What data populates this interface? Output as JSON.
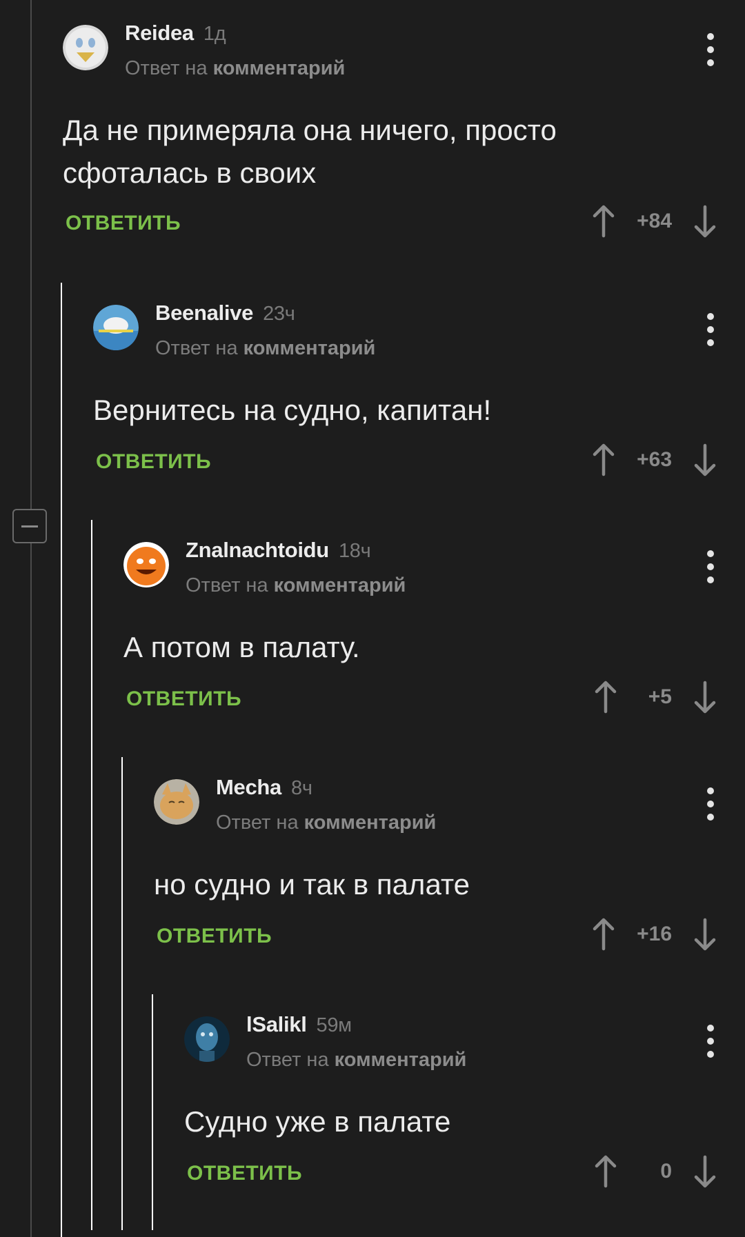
{
  "comments": [
    {
      "author": "Reidea",
      "time": "1д",
      "reply_prefix": "Ответ на",
      "reply_target": "комментарий",
      "text": "Да не примеряла она ничего, просто\nсфоталась в своих",
      "reply_label": "ОТВЕТИТЬ",
      "score": "+84"
    },
    {
      "author": "Beenalive",
      "time": "23ч",
      "reply_prefix": "Ответ на",
      "reply_target": "комментарий",
      "text": "Вернитесь на судно, капитан!",
      "reply_label": "ОТВЕТИТЬ",
      "score": "+63"
    },
    {
      "author": "Znalnachtoidu",
      "time": "18ч",
      "reply_prefix": "Ответ на",
      "reply_target": "комментарий",
      "text": "А потом в палату.",
      "reply_label": "ОТВЕТИТЬ",
      "score": "+5"
    },
    {
      "author": "Mecha",
      "time": "8ч",
      "reply_prefix": "Ответ на",
      "reply_target": "комментарий",
      "text": "но судно и так в палате",
      "reply_label": "ОТВЕТИТЬ",
      "score": "+16"
    },
    {
      "author": "lSalikl",
      "time": "59м",
      "reply_prefix": "Ответ на",
      "reply_target": "комментарий",
      "text": "Судно уже в палате",
      "reply_label": "ОТВЕТИТЬ",
      "score": "0"
    }
  ],
  "colors": {
    "background": "#1d1d1d",
    "reply_accent": "#7cc04a",
    "muted_text": "#7c7c7c",
    "thread_line": "#ffffff",
    "root_thread_line": "#4a4a4a"
  },
  "icons": {
    "upvote": "arrow-up-icon",
    "downvote": "arrow-down-icon",
    "menu": "more-vertical-icon",
    "collapse": "minus-square-icon"
  }
}
